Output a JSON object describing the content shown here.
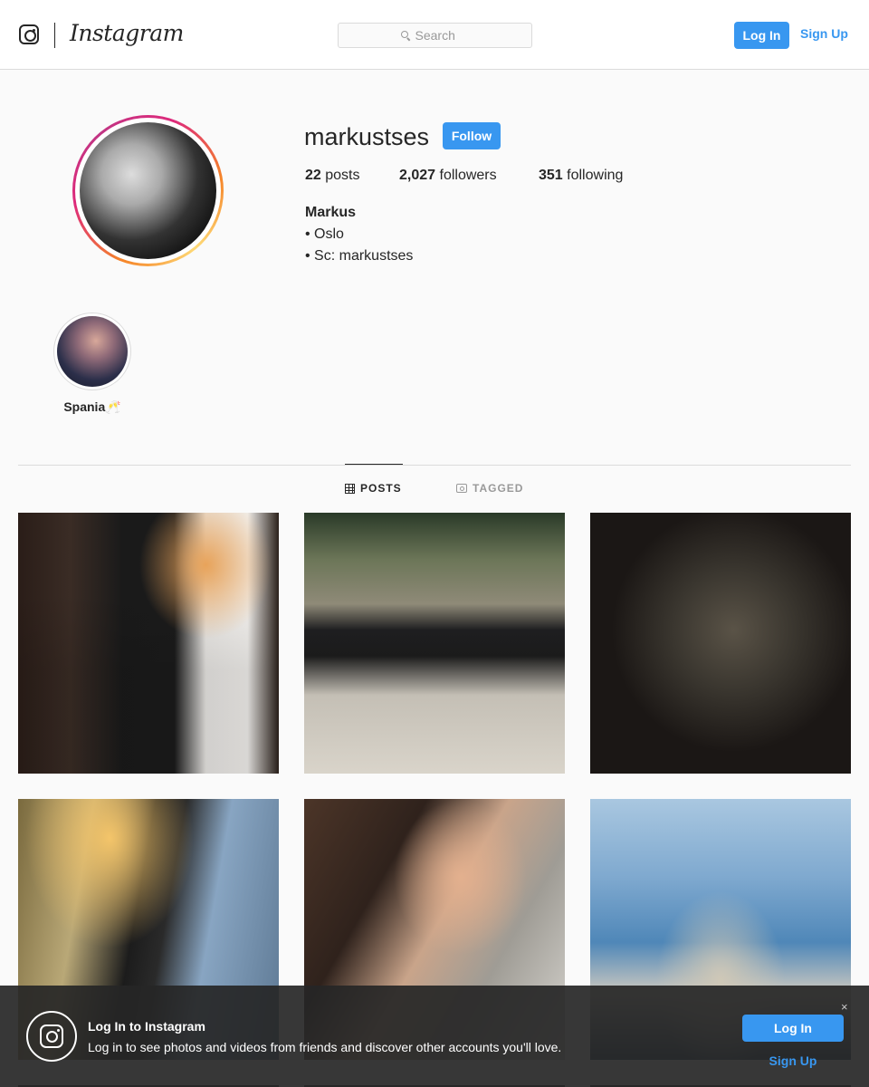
{
  "header": {
    "wordmark": "Instagram",
    "search_placeholder": "Search",
    "login_label": "Log In",
    "signup_label": "Sign Up"
  },
  "profile": {
    "username": "markustses",
    "follow_label": "Follow",
    "posts_count": "22",
    "posts_label": "posts",
    "followers_count": "2,027",
    "followers_label": "followers",
    "following_count": "351",
    "following_label": "following",
    "full_name": "Markus",
    "bio_lines": [
      "• Oslo",
      "• Sc: markustses"
    ]
  },
  "highlights": [
    {
      "label": "Spania🥂"
    }
  ],
  "tabs": [
    {
      "label": "POSTS",
      "icon": "grid-icon",
      "active": true
    },
    {
      "label": "TAGGED",
      "icon": "tag-icon",
      "active": false
    }
  ],
  "login_bar": {
    "title": "Log In to Instagram",
    "text": "Log in to see photos and videos from friends and discover other accounts you'll love.",
    "close": "×",
    "login_label": "Log In",
    "signup_label": "Sign Up"
  },
  "colors": {
    "accent": "#3897f0",
    "text": "#262626",
    "muted": "#999999",
    "border": "#dbdbdb",
    "background": "#fafafa"
  }
}
